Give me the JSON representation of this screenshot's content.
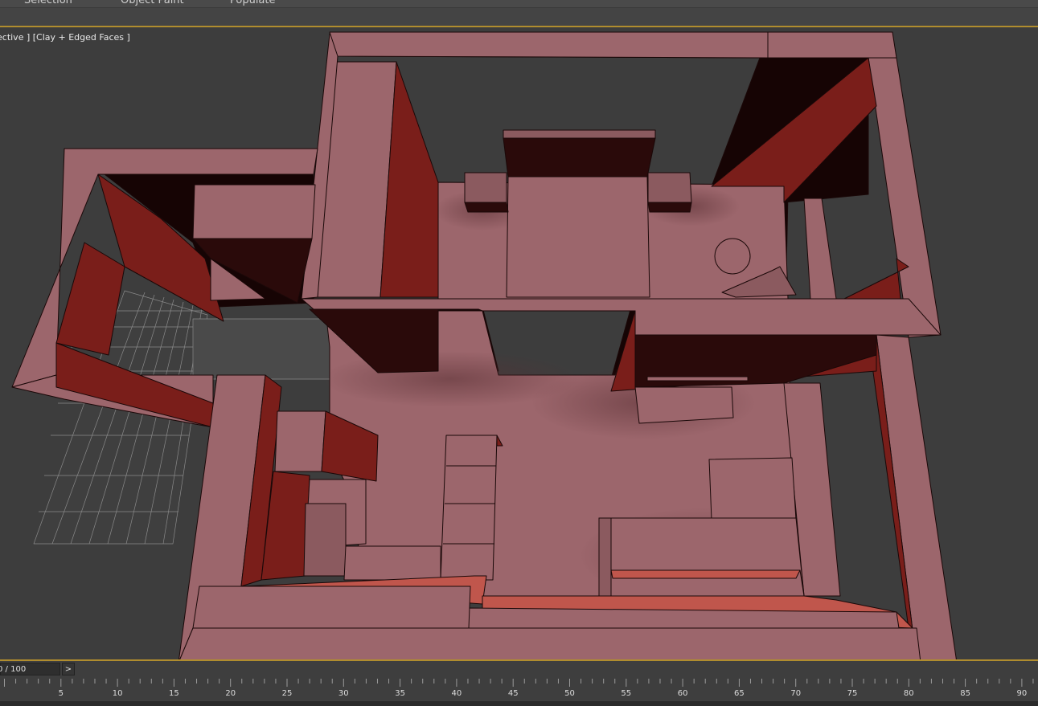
{
  "menu": {
    "tabs": [
      {
        "label": "Selection"
      },
      {
        "label": "Object Paint"
      },
      {
        "label": "Populate"
      }
    ]
  },
  "viewport": {
    "label": "ective ] [Clay + Edged Faces ]"
  },
  "timeline": {
    "frame_display": "0 / 100",
    "next_button": ">",
    "ruler_labels": [
      "5",
      "10",
      "15",
      "20",
      "25",
      "30",
      "35",
      "40",
      "45",
      "50",
      "55",
      "60",
      "65",
      "70",
      "75",
      "80",
      "85",
      "90"
    ]
  },
  "colors": {
    "clay_light": "#9c666c",
    "clay_mid": "#8b5a5f",
    "clay_red": "#7a1e1a",
    "clay_dark": "#160404",
    "viewport_bg": "#3d3d3d",
    "accent_border": "#b08d2e"
  }
}
